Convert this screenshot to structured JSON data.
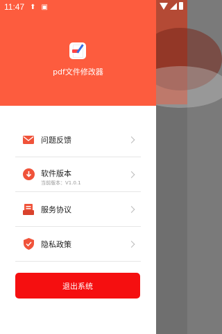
{
  "status_bar": {
    "time": "11:47",
    "icons": [
      "upload-icon",
      "a-icon"
    ]
  },
  "drawer": {
    "app_name": "pdf文件修改器",
    "menu": [
      {
        "label": "问题反馈",
        "icon": "mail-icon"
      },
      {
        "label": "软件版本",
        "sub": "当前版本：V1.0.1",
        "icon": "download-icon"
      },
      {
        "label": "服务协议",
        "icon": "document-icon"
      },
      {
        "label": "隐私政策",
        "icon": "shield-icon"
      }
    ],
    "logout_label": "退出系统"
  },
  "colors": {
    "accent": "#fd5c3e",
    "logout": "#f50f10"
  }
}
